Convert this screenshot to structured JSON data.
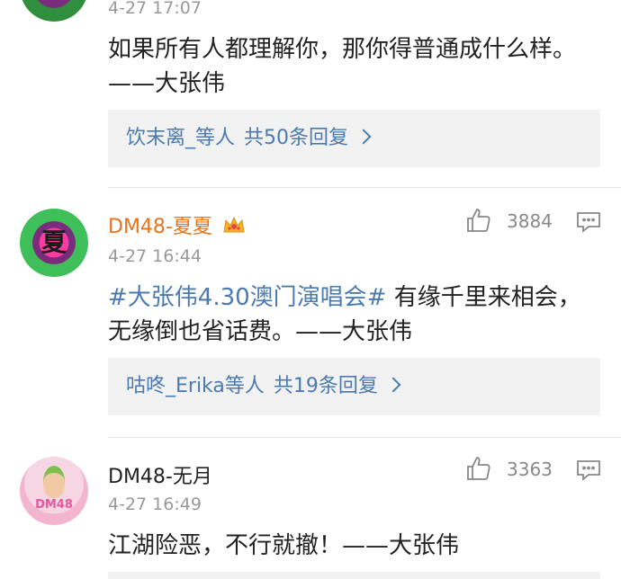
{
  "comments": [
    {
      "time": "4-27 17:07",
      "text": "如果所有人都理解你，那你得普通成什么样。——大张伟",
      "reply": {
        "users": "饮末离_",
        "etc": "等人",
        "total": "共50条回复"
      }
    },
    {
      "name": "DM48-夏夏",
      "likes": "3884",
      "time": "4-27 16:44",
      "topic": "#大张伟4.30澳门演唱会#",
      "text": "有缘千里来相会，无缘倒也省话费。——大张伟",
      "reply": {
        "users": "咕咚_Erika",
        "etc": "等人",
        "total": "共19条回复"
      },
      "avatar_char": "夏"
    },
    {
      "name": "DM48-无月",
      "likes": "3363",
      "time": "4-27 16:49",
      "text": "江湖险恶，不行就撤！——大张伟",
      "avatar_text": "DM48"
    }
  ],
  "colors": {
    "name_vip": "#e8731a",
    "link": "#4a7ab0",
    "meta": "#999999"
  }
}
